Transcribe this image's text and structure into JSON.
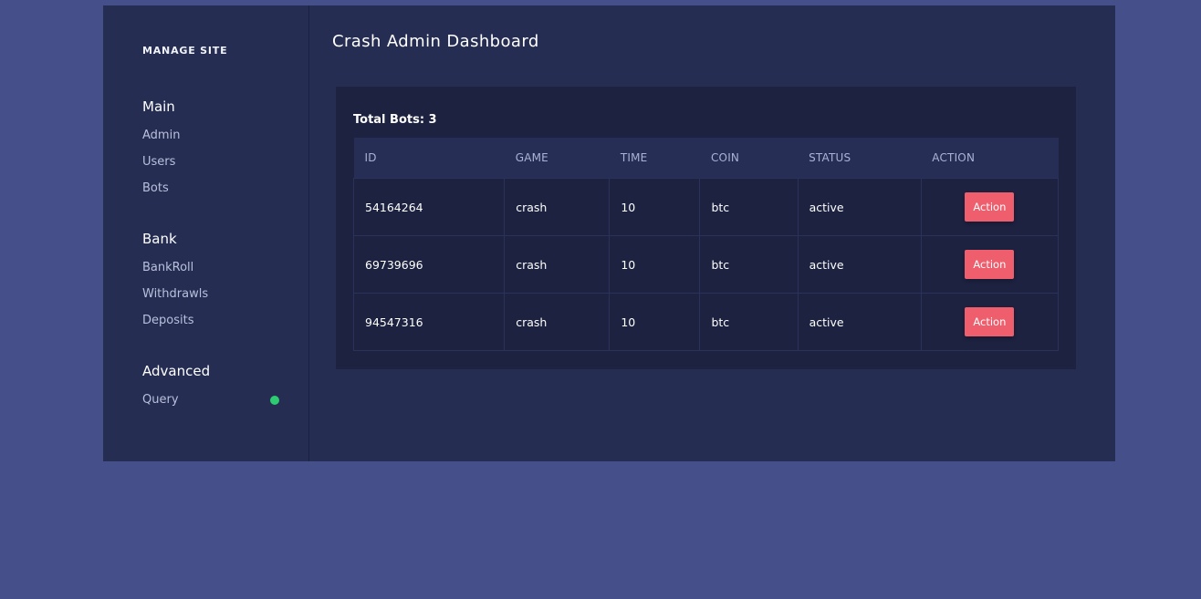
{
  "sidebar": {
    "brand": "MANAGE SITE",
    "groups": [
      {
        "title": "Main",
        "items": [
          "Admin",
          "Users",
          "Bots"
        ]
      },
      {
        "title": "Bank",
        "items": [
          "BankRoll",
          "Withdrawls",
          "Deposits"
        ]
      },
      {
        "title": "Advanced",
        "items": [
          "Query"
        ]
      }
    ],
    "status_color": "#2ecc71"
  },
  "main": {
    "title": "Crash Admin Dashboard",
    "total_bots": "Total Bots: 3",
    "table": {
      "headers": [
        "ID",
        "GAME",
        "TIME",
        "COIN",
        "STATUS",
        "ACTION"
      ],
      "rows": [
        {
          "id": "54164264",
          "game": "crash",
          "time": "10",
          "coin": "btc",
          "status": "active",
          "action": "Action"
        },
        {
          "id": "69739696",
          "game": "crash",
          "time": "10",
          "coin": "btc",
          "status": "active",
          "action": "Action"
        },
        {
          "id": "94547316",
          "game": "crash",
          "time": "10",
          "coin": "btc",
          "status": "active",
          "action": "Action"
        }
      ]
    }
  },
  "colors": {
    "page_background": "#45508b",
    "panel": "#252d52",
    "card": "#1c2240",
    "accent_button": "#ef5e6d"
  }
}
